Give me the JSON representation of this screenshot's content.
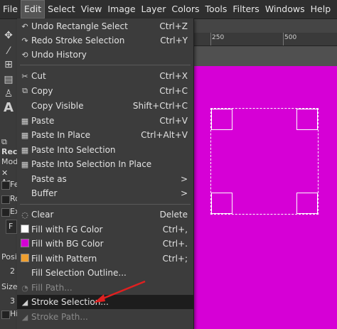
{
  "menubar": {
    "items": [
      "File",
      "Edit",
      "Select",
      "View",
      "Image",
      "Layer",
      "Colors",
      "Tools",
      "Filters",
      "Windows",
      "Help"
    ],
    "active": "Edit"
  },
  "ruler": {
    "labels": [
      "250",
      "500"
    ]
  },
  "toolbox": {
    "labels": [
      "Rec",
      "Mod",
      "Ar",
      "Fe",
      "Ro",
      "Ex",
      "F",
      "Posi",
      "2",
      "Size",
      "3",
      "Hi"
    ]
  },
  "menu": {
    "items": [
      {
        "label": "Undo Rectangle Select",
        "accel": "Ctrl+Z",
        "icon": "undo-icon",
        "disabled": false
      },
      {
        "label": "Redo Stroke Selection",
        "accel": "Ctrl+Y",
        "icon": "redo-icon",
        "disabled": false
      },
      {
        "label": "Undo History",
        "accel": "",
        "icon": "history-icon",
        "disabled": false
      },
      {
        "label": "Cut",
        "accel": "Ctrl+X",
        "icon": "scissors-icon",
        "disabled": false
      },
      {
        "label": "Copy",
        "accel": "Ctrl+C",
        "icon": "copy-icon",
        "disabled": false
      },
      {
        "label": "Copy Visible",
        "accel": "Shift+Ctrl+C",
        "icon": "",
        "disabled": false
      },
      {
        "label": "Paste",
        "accel": "Ctrl+V",
        "icon": "paste-icon",
        "disabled": false
      },
      {
        "label": "Paste In Place",
        "accel": "Ctrl+Alt+V",
        "icon": "paste-icon",
        "disabled": false
      },
      {
        "label": "Paste Into Selection",
        "accel": "",
        "icon": "paste-icon",
        "disabled": false
      },
      {
        "label": "Paste Into Selection In Place",
        "accel": "",
        "icon": "paste-icon",
        "disabled": false
      },
      {
        "label": "Paste as",
        "accel": ">",
        "icon": "",
        "disabled": false
      },
      {
        "label": "Buffer",
        "accel": ">",
        "icon": "",
        "disabled": false
      },
      {
        "label": "Clear",
        "accel": "Delete",
        "icon": "clear-icon",
        "disabled": false
      },
      {
        "label": "Fill with FG Color",
        "accel": "Ctrl+,",
        "icon": "fg-swatch",
        "disabled": false
      },
      {
        "label": "Fill with BG Color",
        "accel": "Ctrl+.",
        "icon": "bg-swatch",
        "disabled": false
      },
      {
        "label": "Fill with Pattern",
        "accel": "Ctrl+;",
        "icon": "pattern-swatch",
        "disabled": false
      },
      {
        "label": "Fill Selection Outline...",
        "accel": "",
        "icon": "",
        "disabled": false
      },
      {
        "label": "Fill Path...",
        "accel": "",
        "icon": "fill-path-icon",
        "disabled": true
      },
      {
        "label": "Stroke Selection...",
        "accel": "",
        "icon": "stroke-selection-icon",
        "disabled": false
      },
      {
        "label": "Stroke Path...",
        "accel": "",
        "icon": "stroke-path-icon",
        "disabled": true
      }
    ]
  },
  "colors": {
    "canvas": "#d600d6",
    "fg": "#ffffff",
    "bg": "#d600d6",
    "pattern": "#f0a030",
    "arrow": "#e02020"
  }
}
